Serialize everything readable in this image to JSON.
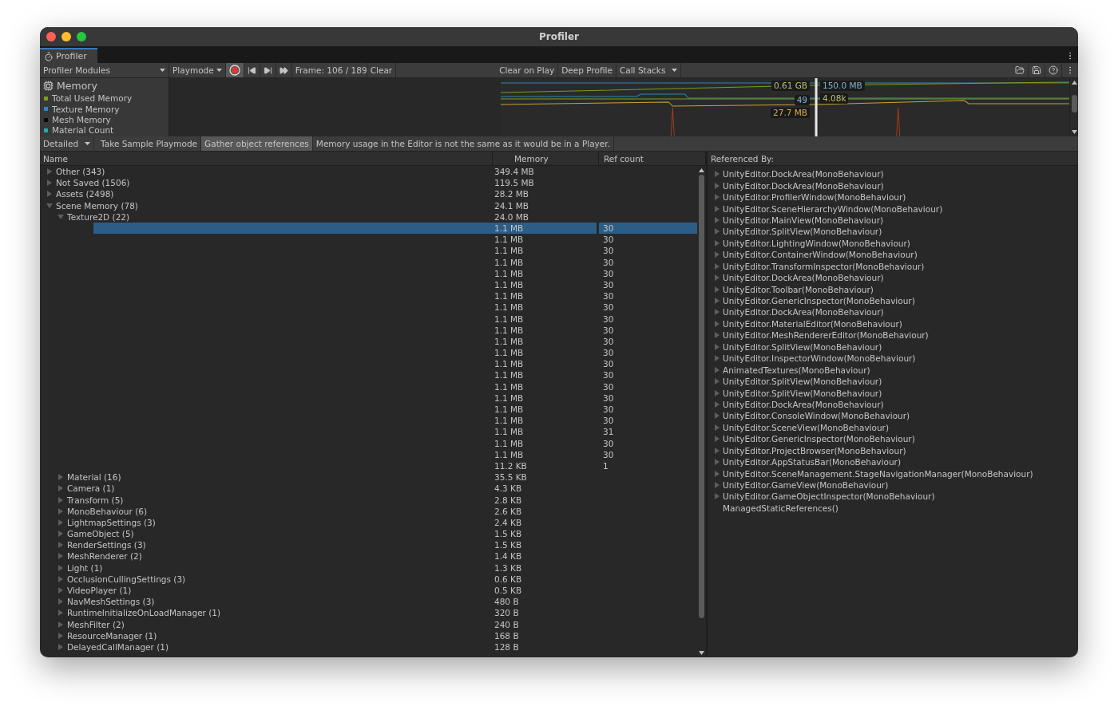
{
  "window": {
    "title": "Profiler"
  },
  "tab": {
    "label": "Profiler",
    "selected": true
  },
  "toolbar": {
    "modules": "Profiler Modules",
    "target": "Playmode",
    "recording": true,
    "frame": "Frame: 106 / 189",
    "clear": "Clear",
    "toggles": [
      {
        "label": "Clear on Play",
        "on": false
      },
      {
        "label": "Deep Profile",
        "on": false
      }
    ],
    "call_stacks": "Call Stacks"
  },
  "module": {
    "title": "Memory",
    "legend": [
      {
        "label": "Total Used Memory",
        "color": "#7f9b1c"
      },
      {
        "label": "Texture Memory",
        "color": "#2f86b8"
      },
      {
        "label": "Mesh Memory",
        "color": "#0a0a0a"
      },
      {
        "label": "Material Count",
        "color": "#2aa6a6"
      }
    ]
  },
  "graph": {
    "readouts": [
      {
        "text": "0.61 GB",
        "color": "#b7c46c"
      },
      {
        "text": "150.0 MB",
        "color": "#7fb2d0"
      },
      {
        "text": "49",
        "color": "#7fb2d0"
      },
      {
        "text": "4.08k",
        "color": "#b7c46c"
      },
      {
        "text": "27.7 MB",
        "color": "#d4b24c"
      }
    ]
  },
  "detail_bar": {
    "view": "Detailed",
    "toggles": [
      {
        "label": "Take Sample Playmode",
        "on": false
      },
      {
        "label": "Gather object references",
        "on": true
      }
    ],
    "message": "Memory usage in the Editor is not the same as it would be in a Player."
  },
  "table": {
    "columns": [
      "Name",
      "Memory",
      "Ref count"
    ],
    "rows": [
      {
        "name": "Other (343)",
        "memory": "349.4 MB",
        "expanded": false
      },
      {
        "name": "Not Saved (1506)",
        "memory": "119.5 MB",
        "expanded": false
      },
      {
        "name": "Assets (2498)",
        "memory": "28.2 MB",
        "expanded": false
      },
      {
        "name": "Scene Memory (78)",
        "memory": "24.1 MB",
        "expanded": true,
        "children": [
          {
            "name": "Texture2D (22)",
            "memory": "24.0 MB",
            "expanded": true,
            "children": [
              {
                "memory": "1.1 MB",
                "ref_count": "30",
                "selected": true
              },
              {
                "memory": "1.1 MB",
                "ref_count": "30",
                "selected": false
              },
              {
                "memory": "1.1 MB",
                "ref_count": "30",
                "selected": false
              },
              {
                "memory": "1.1 MB",
                "ref_count": "30",
                "selected": false
              },
              {
                "memory": "1.1 MB",
                "ref_count": "30",
                "selected": false
              },
              {
                "memory": "1.1 MB",
                "ref_count": "30",
                "selected": false
              },
              {
                "memory": "1.1 MB",
                "ref_count": "30",
                "selected": false
              },
              {
                "memory": "1.1 MB",
                "ref_count": "30",
                "selected": false
              },
              {
                "memory": "1.1 MB",
                "ref_count": "30",
                "selected": false
              },
              {
                "memory": "1.1 MB",
                "ref_count": "30",
                "selected": false
              },
              {
                "memory": "1.1 MB",
                "ref_count": "30",
                "selected": false
              },
              {
                "memory": "1.1 MB",
                "ref_count": "30",
                "selected": false
              },
              {
                "memory": "1.1 MB",
                "ref_count": "30",
                "selected": false
              },
              {
                "memory": "1.1 MB",
                "ref_count": "30",
                "selected": false
              },
              {
                "memory": "1.1 MB",
                "ref_count": "30",
                "selected": false
              },
              {
                "memory": "1.1 MB",
                "ref_count": "30",
                "selected": false
              },
              {
                "memory": "1.1 MB",
                "ref_count": "30",
                "selected": false
              },
              {
                "memory": "1.1 MB",
                "ref_count": "30",
                "selected": false
              },
              {
                "memory": "1.1 MB",
                "ref_count": "31",
                "selected": false
              },
              {
                "memory": "1.1 MB",
                "ref_count": "30",
                "selected": false
              },
              {
                "memory": "1.1 MB",
                "ref_count": "30",
                "selected": false
              },
              {
                "memory": "11.2 KB",
                "ref_count": "1",
                "selected": false
              }
            ]
          },
          {
            "name": "Material (16)",
            "memory": "35.5 KB",
            "expanded": false
          },
          {
            "name": "Camera (1)",
            "memory": "4.3 KB",
            "expanded": false
          },
          {
            "name": "Transform (5)",
            "memory": "2.8 KB",
            "expanded": false
          },
          {
            "name": "MonoBehaviour (6)",
            "memory": "2.6 KB",
            "expanded": false
          },
          {
            "name": "LightmapSettings (3)",
            "memory": "2.4 KB",
            "expanded": false
          },
          {
            "name": "GameObject (5)",
            "memory": "1.5 KB",
            "expanded": false
          },
          {
            "name": "RenderSettings (3)",
            "memory": "1.5 KB",
            "expanded": false
          },
          {
            "name": "MeshRenderer (2)",
            "memory": "1.4 KB",
            "expanded": false
          },
          {
            "name": "Light (1)",
            "memory": "1.3 KB",
            "expanded": false
          },
          {
            "name": "OcclusionCullingSettings (3)",
            "memory": "0.6 KB",
            "expanded": false
          },
          {
            "name": "VideoPlayer (1)",
            "memory": "0.5 KB",
            "expanded": false
          },
          {
            "name": "NavMeshSettings (3)",
            "memory": "480 B",
            "expanded": false
          },
          {
            "name": "RuntimeInitializeOnLoadManager (1)",
            "memory": "320 B",
            "expanded": false
          },
          {
            "name": "MeshFilter (2)",
            "memory": "240 B",
            "expanded": false
          },
          {
            "name": "ResourceManager (1)",
            "memory": "168 B",
            "expanded": false
          },
          {
            "name": "DelayedCallManager (1)",
            "memory": "128 B",
            "expanded": false
          }
        ]
      }
    ]
  },
  "references": {
    "title": "Referenced By:",
    "items": [
      {
        "label": "UnityEditor.DockArea(MonoBehaviour)",
        "expandable": true
      },
      {
        "label": "UnityEditor.DockArea(MonoBehaviour)",
        "expandable": true
      },
      {
        "label": "UnityEditor.ProfilerWindow(MonoBehaviour)",
        "expandable": true
      },
      {
        "label": "UnityEditor.SceneHierarchyWindow(MonoBehaviour)",
        "expandable": true
      },
      {
        "label": "UnityEditor.MainView(MonoBehaviour)",
        "expandable": true
      },
      {
        "label": "UnityEditor.SplitView(MonoBehaviour)",
        "expandable": true
      },
      {
        "label": "UnityEditor.LightingWindow(MonoBehaviour)",
        "expandable": true
      },
      {
        "label": "UnityEditor.ContainerWindow(MonoBehaviour)",
        "expandable": true
      },
      {
        "label": "UnityEditor.TransformInspector(MonoBehaviour)",
        "expandable": true
      },
      {
        "label": "UnityEditor.DockArea(MonoBehaviour)",
        "expandable": true
      },
      {
        "label": "UnityEditor.Toolbar(MonoBehaviour)",
        "expandable": true
      },
      {
        "label": "UnityEditor.GenericInspector(MonoBehaviour)",
        "expandable": true
      },
      {
        "label": "UnityEditor.DockArea(MonoBehaviour)",
        "expandable": true
      },
      {
        "label": "UnityEditor.MaterialEditor(MonoBehaviour)",
        "expandable": true
      },
      {
        "label": "UnityEditor.MeshRendererEditor(MonoBehaviour)",
        "expandable": true
      },
      {
        "label": "UnityEditor.SplitView(MonoBehaviour)",
        "expandable": true
      },
      {
        "label": "UnityEditor.InspectorWindow(MonoBehaviour)",
        "expandable": true
      },
      {
        "label": "AnimatedTextures(MonoBehaviour)",
        "expandable": true
      },
      {
        "label": "UnityEditor.SplitView(MonoBehaviour)",
        "expandable": true
      },
      {
        "label": "UnityEditor.SplitView(MonoBehaviour)",
        "expandable": true
      },
      {
        "label": "UnityEditor.DockArea(MonoBehaviour)",
        "expandable": true
      },
      {
        "label": "UnityEditor.ConsoleWindow(MonoBehaviour)",
        "expandable": true
      },
      {
        "label": "UnityEditor.SceneView(MonoBehaviour)",
        "expandable": true
      },
      {
        "label": "UnityEditor.GenericInspector(MonoBehaviour)",
        "expandable": true
      },
      {
        "label": "UnityEditor.ProjectBrowser(MonoBehaviour)",
        "expandable": true
      },
      {
        "label": "UnityEditor.AppStatusBar(MonoBehaviour)",
        "expandable": true
      },
      {
        "label": "UnityEditor.SceneManagement.StageNavigationManager(MonoBehaviour)",
        "expandable": true
      },
      {
        "label": "UnityEditor.GameView(MonoBehaviour)",
        "expandable": true
      },
      {
        "label": "UnityEditor.GameObjectInspector(MonoBehaviour)",
        "expandable": true
      },
      {
        "label": "ManagedStaticReferences()",
        "expandable": false
      }
    ]
  }
}
